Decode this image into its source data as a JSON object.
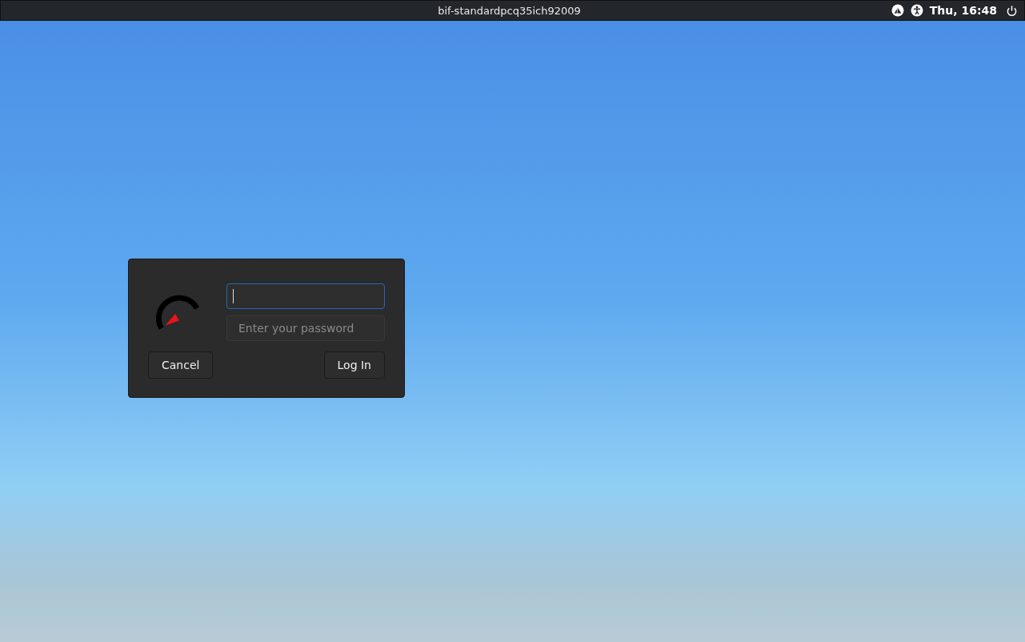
{
  "top_bar": {
    "hostname": "bif-standardpcq35ich92009",
    "clock": "Thu, 16:48"
  },
  "login_dialog": {
    "username_field": {
      "focused": true
    },
    "password_field": {
      "placeholder": "Enter your password",
      "focused": false
    },
    "buttons": [
      {
        "label": "Cancel"
      },
      {
        "label": "Log In"
      }
    ]
  }
}
